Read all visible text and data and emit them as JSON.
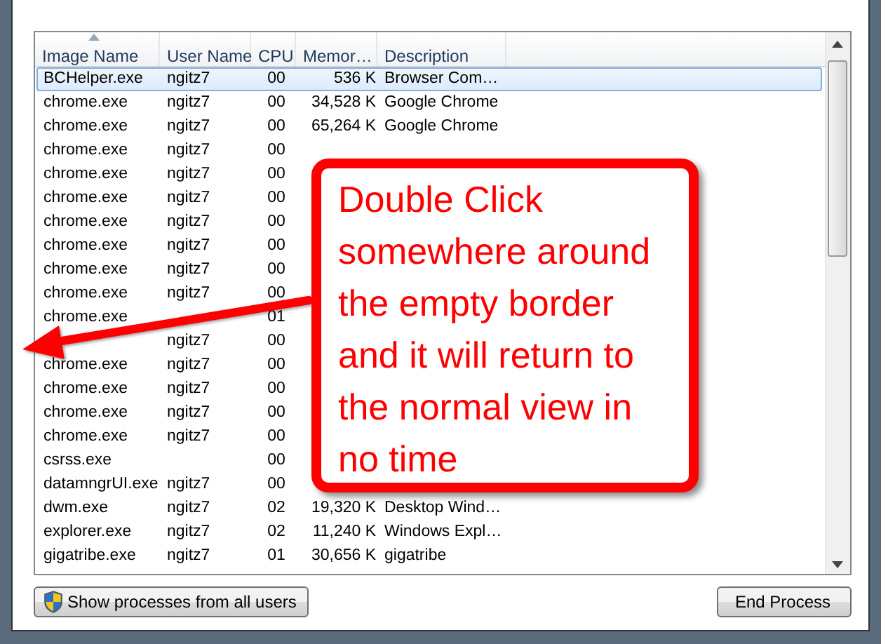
{
  "table": {
    "columns": [
      {
        "label": "Image Name",
        "sorted": true
      },
      {
        "label": "User Name"
      },
      {
        "label": "CPU"
      },
      {
        "label": "Memor…"
      },
      {
        "label": "Description"
      }
    ],
    "rows": [
      {
        "cells": [
          "BCHelper.exe",
          "ngitz7",
          "00",
          "536 K",
          "Browser Com…"
        ],
        "selected": true
      },
      {
        "cells": [
          "chrome.exe",
          "ngitz7",
          "00",
          "34,528 K",
          "Google Chrome"
        ],
        "selected": false
      },
      {
        "cells": [
          "chrome.exe",
          "ngitz7",
          "00",
          "65,264 K",
          "Google Chrome"
        ],
        "selected": false
      },
      {
        "cells": [
          "chrome.exe",
          "ngitz7",
          "00",
          "",
          ""
        ],
        "selected": false
      },
      {
        "cells": [
          "chrome.exe",
          "ngitz7",
          "00",
          "",
          ""
        ],
        "selected": false
      },
      {
        "cells": [
          "chrome.exe",
          "ngitz7",
          "00",
          "",
          ""
        ],
        "selected": false
      },
      {
        "cells": [
          "chrome.exe",
          "ngitz7",
          "00",
          "",
          ""
        ],
        "selected": false
      },
      {
        "cells": [
          "chrome.exe",
          "ngitz7",
          "00",
          "",
          ""
        ],
        "selected": false
      },
      {
        "cells": [
          "chrome.exe",
          "ngitz7",
          "00",
          "",
          ""
        ],
        "selected": false
      },
      {
        "cells": [
          "chrome.exe",
          "ngitz7",
          "00",
          "",
          ""
        ],
        "selected": false
      },
      {
        "cells": [
          "chrome.exe",
          "",
          "01",
          "",
          ""
        ],
        "selected": false
      },
      {
        "cells": [
          "",
          "ngitz7",
          "00",
          "",
          ""
        ],
        "selected": false
      },
      {
        "cells": [
          "chrome.exe",
          "ngitz7",
          "00",
          "",
          ""
        ],
        "selected": false
      },
      {
        "cells": [
          "chrome.exe",
          "ngitz7",
          "00",
          "",
          ""
        ],
        "selected": false
      },
      {
        "cells": [
          "chrome.exe",
          "ngitz7",
          "00",
          "",
          ""
        ],
        "selected": false
      },
      {
        "cells": [
          "chrome.exe",
          "ngitz7",
          "00",
          "",
          ""
        ],
        "selected": false
      },
      {
        "cells": [
          "csrss.exe",
          "",
          "00",
          "",
          ""
        ],
        "selected": false
      },
      {
        "cells": [
          "datamngrUI.exe",
          "ngitz7",
          "00",
          "",
          ""
        ],
        "selected": false
      },
      {
        "cells": [
          "dwm.exe",
          "ngitz7",
          "02",
          "19,320 K",
          "Desktop Wind…"
        ],
        "selected": false
      },
      {
        "cells": [
          "explorer.exe",
          "ngitz7",
          "02",
          "11,240 K",
          "Windows Expl…"
        ],
        "selected": false
      },
      {
        "cells": [
          "gigatribe.exe",
          "ngitz7",
          "01",
          "30,656 K",
          "gigatribe"
        ],
        "selected": false
      }
    ]
  },
  "buttons": [
    {
      "label": "Show processes from all users",
      "kind": "shield"
    },
    {
      "label": "End Process",
      "kind": "plain"
    }
  ],
  "callout": {
    "text": "Double Click somewhere around the empty border and it will return to the normal view in no time"
  }
}
